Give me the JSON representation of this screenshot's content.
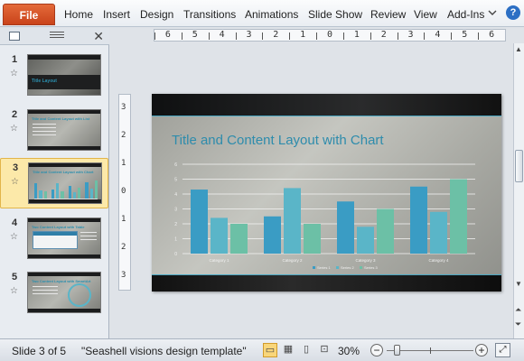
{
  "ribbon": {
    "file_label": "File",
    "tabs": [
      "Home",
      "Insert",
      "Design",
      "Transitions",
      "Animations",
      "Slide Show",
      "Review",
      "View",
      "Add-Ins"
    ],
    "minimize_icon": "chevron-down-icon",
    "help_icon": "?"
  },
  "panel": {
    "close_icon": "✕",
    "slides": [
      {
        "num": "1",
        "title": "Title Layout"
      },
      {
        "num": "2",
        "title": "Title and Content Layout with List"
      },
      {
        "num": "3",
        "title": "Title and Content Layout with Chart"
      },
      {
        "num": "4",
        "title": "Two Content Layout with Table"
      },
      {
        "num": "5",
        "title": "Two Content Layout with SmartArt"
      }
    ],
    "active_slide": 3
  },
  "ruler": {
    "h_labels": [
      "6",
      "5",
      "4",
      "3",
      "2",
      "1",
      "0",
      "1",
      "2",
      "3",
      "4",
      "5",
      "6"
    ],
    "v_labels": [
      "3",
      "2",
      "1",
      "0",
      "1",
      "2",
      "3"
    ]
  },
  "slide": {
    "title": "Title and Content Layout with Chart"
  },
  "chart_data": {
    "type": "bar",
    "categories": [
      "Category 1",
      "Category 2",
      "Category 3",
      "Category 4"
    ],
    "series": [
      {
        "name": "Series 1",
        "values": [
          4.3,
          2.5,
          3.5,
          4.5
        ],
        "color": "#3a9cc4"
      },
      {
        "name": "Series 2",
        "values": [
          2.4,
          4.4,
          1.8,
          2.8
        ],
        "color": "#5ab5c8"
      },
      {
        "name": "Series 3",
        "values": [
          2.0,
          2.0,
          3.0,
          5.0
        ],
        "color": "#6cc0a6"
      }
    ],
    "ylim": [
      0,
      6
    ],
    "y_ticks": [
      "0",
      "1",
      "2",
      "3",
      "4",
      "5",
      "6"
    ],
    "grid": true,
    "legend": "bottom"
  },
  "status": {
    "slide_count": "Slide 3 of 5",
    "theme": "\"Seashell visions design template\"",
    "zoom": "30%",
    "zoom_out": "−",
    "zoom_in": "+",
    "zoom_fraction": 0.3
  },
  "colors": {
    "accent": "#2e8cac",
    "file_tab": "#d4542a",
    "active_thumb": "#fce9a9"
  }
}
